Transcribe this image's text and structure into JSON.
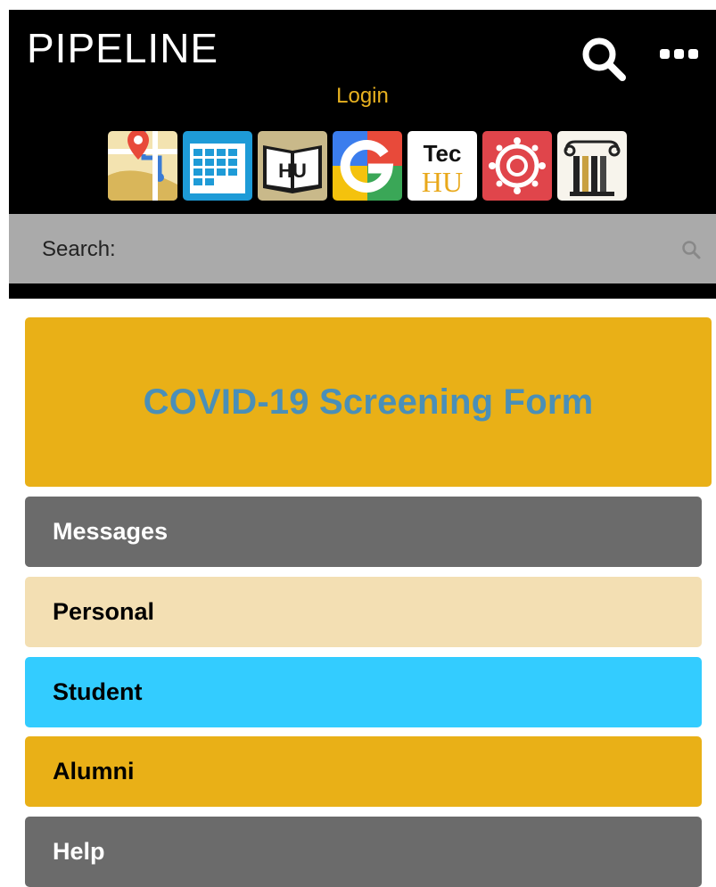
{
  "header": {
    "brand": "PIPELINE",
    "login_label": "Login",
    "login_color": "#e8b220",
    "background": "#000000"
  },
  "apps": [
    {
      "name": "map",
      "icon": "map-pin-icon"
    },
    {
      "name": "calendar",
      "icon": "calendar-icon"
    },
    {
      "name": "hu-book",
      "icon": "open-book-icon",
      "text": "HU"
    },
    {
      "name": "google",
      "icon": "google-g-icon"
    },
    {
      "name": "tec-hu",
      "icon": "tec-hu-icon",
      "text_top": "Tec",
      "text_bottom": "HU"
    },
    {
      "name": "canvas",
      "icon": "canvas-icon"
    },
    {
      "name": "library",
      "icon": "library-column-icon"
    }
  ],
  "search": {
    "label": "Search:",
    "placeholder": "",
    "bar_color": "#aaaaaa"
  },
  "covid": {
    "title": "COVID-19 Screening Form",
    "background": "#e9b017",
    "text_color": "#4a8fb8"
  },
  "nav": [
    {
      "label": "Messages",
      "background": "#6b6b6b",
      "text_color": "#ffffff"
    },
    {
      "label": "Personal",
      "background": "#f3dfb3",
      "text_color": "#000000"
    },
    {
      "label": "Student",
      "background": "#33ccff",
      "text_color": "#000000"
    },
    {
      "label": "Alumni",
      "background": "#e9b017",
      "text_color": "#000000"
    },
    {
      "label": "Help",
      "background": "#6b6b6b",
      "text_color": "#ffffff"
    }
  ]
}
